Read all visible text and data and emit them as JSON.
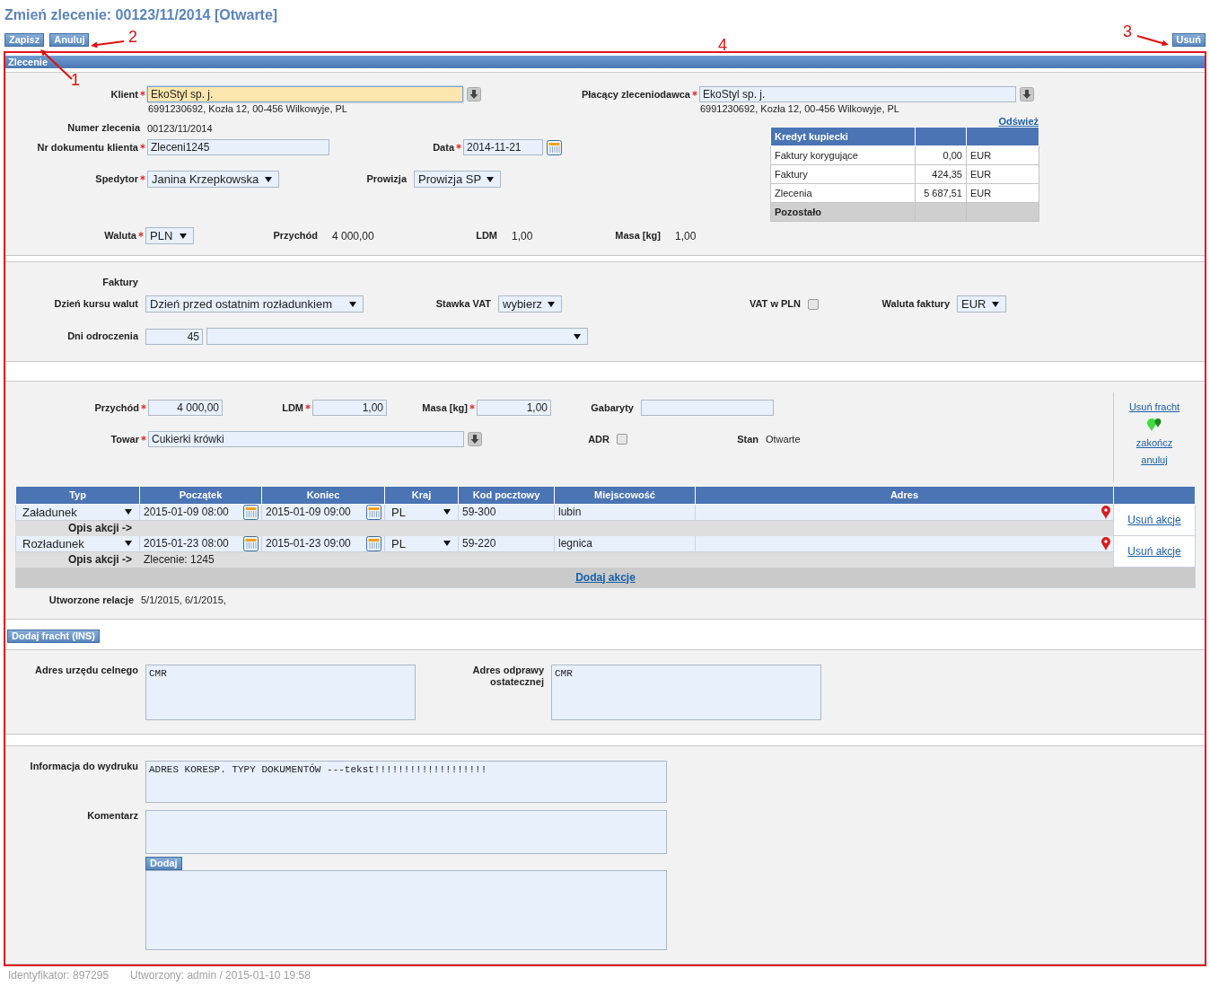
{
  "title": "Zmień zlecenie: 00123/11/2014 [Otwarte]",
  "toolbar": {
    "left": [
      {
        "label": "Zapisz"
      },
      {
        "label": "Anuluj"
      }
    ],
    "right": [
      {
        "label": "Usuń"
      }
    ]
  },
  "annotations": [
    {
      "kind": "arrow",
      "number": "1"
    },
    {
      "kind": "arrow",
      "number": "2"
    },
    {
      "kind": "arrow",
      "number": "3"
    },
    {
      "kind": "label",
      "number": "4"
    }
  ],
  "panel": {
    "title": "Zlecenie"
  },
  "order": {
    "client": {
      "label": "Klient",
      "required": true,
      "value": "EkoStyl sp. j.",
      "focused": true,
      "details": "6991230692, Kozła 12, 00-456 Wilkowyje, PL"
    },
    "order_number": {
      "label": "Numer zlecenia",
      "value": "00123/11/2014"
    },
    "client_document": {
      "label": "Nr dokumentu klienta",
      "required": true,
      "value": "Zleceni1245"
    },
    "date": {
      "label": "Data",
      "required": true,
      "value": "2014-11-21"
    },
    "forwarder": {
      "label": "Spedytor",
      "required": true,
      "value": "Janina Krzepkowska"
    },
    "commission": {
      "label": "Prowizja",
      "required": false,
      "value": "Prowizja SP"
    },
    "payer": {
      "label": "Płacący zleceniodawca",
      "required": true,
      "value": "EkoStyl sp. j.",
      "focused": false,
      "details": "6991230692, Kozła 12, 00-456 Wilkowyje, PL"
    },
    "refresh_link": "Odśwież",
    "credit_table": {
      "title": "Kredyt kupiecki",
      "rows": [
        {
          "name": "Faktury korygujące",
          "amount": "0,00",
          "currency": "EUR"
        },
        {
          "name": "Faktury",
          "amount": "424,35",
          "currency": "EUR"
        },
        {
          "name": "Zlecenia",
          "amount": "5 687,51",
          "currency": "EUR"
        }
      ],
      "footer": "Pozostało"
    },
    "summary": [
      {
        "kind": "select",
        "label": "Waluta",
        "required": true,
        "value": "PLN"
      },
      {
        "kind": "value",
        "label": "Przychód",
        "required": false,
        "value": "4 000,00"
      },
      {
        "kind": "value",
        "label": "LDM",
        "required": false,
        "value": "1,00"
      },
      {
        "kind": "value",
        "label": "Masa [kg]",
        "required": false,
        "value": "1,00"
      }
    ]
  },
  "invoices": {
    "heading": "Faktury",
    "rate_day": {
      "label": "Dzień kursu walut",
      "value": "Dzień przed ostatnim rozładunkiem"
    },
    "vat_rate": {
      "label": "Stawka VAT",
      "value": "wybierz"
    },
    "vat_in_pln": {
      "label": "VAT w PLN",
      "checked": false
    },
    "invoice_currency": {
      "label": "Waluta faktury",
      "value": "EUR"
    },
    "deferral_days": {
      "label": "Dni odroczenia",
      "value": "45"
    }
  },
  "freight": {
    "revenue": {
      "label": "Przychód",
      "required": true,
      "value": "4 000,00"
    },
    "ldm": {
      "label": "LDM",
      "required": true,
      "value": "1,00"
    },
    "mass": {
      "label": "Masa [kg]",
      "required": true,
      "value": "1,00"
    },
    "dimensions": {
      "label": "Gabaryty",
      "required": false
    },
    "goods": {
      "label": "Towar",
      "required": true,
      "value": "Cukierki krówki"
    },
    "adr": {
      "label": "ADR",
      "checked": false
    },
    "status": {
      "label": "Stan",
      "value": "Otwarte"
    },
    "links": [
      "Usuń fracht",
      "zakończ",
      "anuluj"
    ],
    "table": {
      "columns": [
        "Typ",
        "Początek",
        "Koniec",
        "Kraj",
        "Kod pocztowy",
        "Miejscowość",
        "Adres"
      ],
      "rows": [
        {
          "type": "Załadunek",
          "start": "2015-01-09 08:00",
          "end": "2015-01-09 09:00",
          "country": "PL",
          "postal_code": "59-300",
          "city": "lubin",
          "description_label": "Opis akcji ->",
          "action": "Usuń akcje"
        },
        {
          "type": "Rozładunek",
          "start": "2015-01-23 08:00",
          "end": "2015-01-23 09:00",
          "country": "PL",
          "postal_code": "59-220",
          "city": "legnica",
          "description_label": "Opis akcji ->",
          "description": "Zlecenie: 1245",
          "action": "Usuń akcje"
        }
      ],
      "add_link": "Dodaj akcje"
    },
    "relations": {
      "label": "Utworzone relacje",
      "value": "5/1/2015, 6/1/2015,"
    }
  },
  "add_freight_button": "Dodaj fracht (INS)",
  "customs": [
    {
      "label": "Adres urzędu celnego",
      "value": "CMR"
    },
    {
      "label": "Adres odprawy ostatecznej",
      "value": "CMR"
    }
  ],
  "print_info": {
    "label": "Informacja do wydruku",
    "value": "ADRES KORESP. TYPY DOKUMENTÓW ---tekst!!!!!!!!!!!!!!!!!!!"
  },
  "comment": {
    "label": "Komentarz",
    "button": "Dodaj"
  },
  "footer": [
    "Identyfikator: 897295",
    "Utworzony: admin / 2015-01-10 19:58"
  ]
}
